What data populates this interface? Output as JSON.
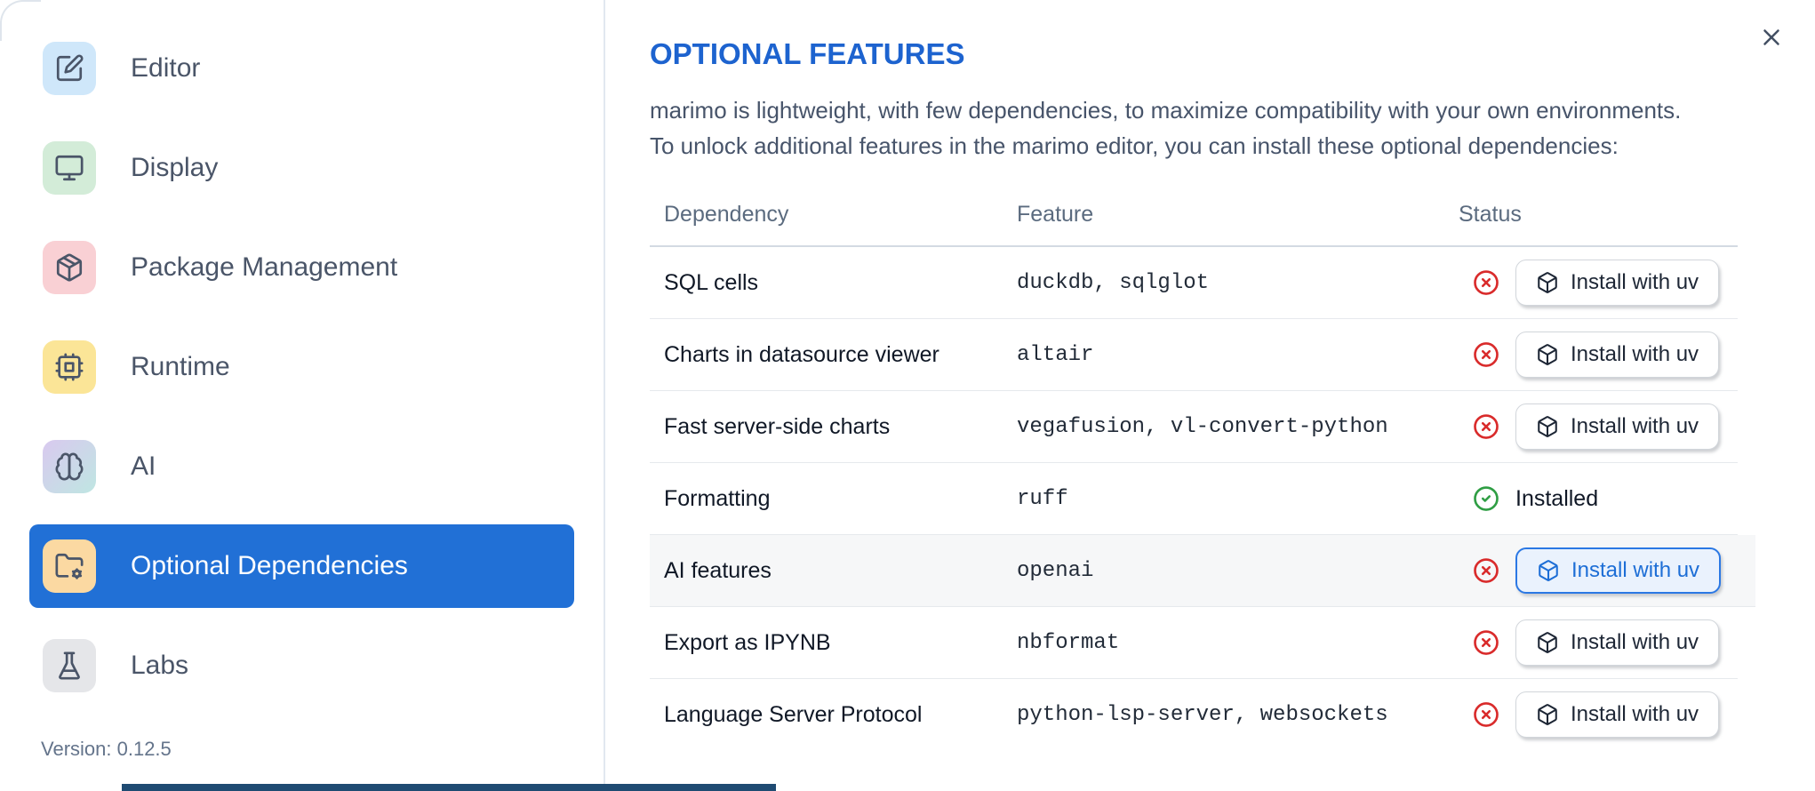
{
  "dialog": {
    "title": "OPTIONAL FEATURES",
    "description_lines": [
      "marimo is lightweight, with few dependencies, to maximize compatibility with your own environments.",
      "To unlock additional features in the marimo editor, you can install these optional dependencies:"
    ],
    "close_icon": "x-icon"
  },
  "sidebar": {
    "items": [
      {
        "label": "Editor",
        "icon": "edit-icon",
        "icon_bg": "#cfe7fa",
        "selected": false
      },
      {
        "label": "Display",
        "icon": "monitor-icon",
        "icon_bg": "#d3ecd8",
        "selected": false
      },
      {
        "label": "Package Management",
        "icon": "package-icon",
        "icon_bg": "#f9d0d4",
        "selected": false
      },
      {
        "label": "Runtime",
        "icon": "cpu-icon",
        "icon_bg": "#fbe597",
        "selected": false
      },
      {
        "label": "AI",
        "icon": "brain-icon",
        "icon_bg": "#d9c9ef",
        "icon_bg2": "#bfe6e2",
        "selected": false
      },
      {
        "label": "Optional Dependencies",
        "icon": "folder-cog-icon",
        "icon_bg": "#fbd9a2",
        "selected": true
      },
      {
        "label": "Labs",
        "icon": "flask-icon",
        "icon_bg": "#e5e6e9",
        "selected": false
      }
    ],
    "version": "Version: 0.12.5"
  },
  "table": {
    "headers": [
      "Dependency",
      "Feature",
      "Status"
    ],
    "status_missing_icon": "circle-x-icon",
    "status_installed_icon": "circle-check-icon",
    "install_button_icon": "box-icon",
    "rows": [
      {
        "dependency": "SQL cells",
        "feature": "duckdb, sqlglot",
        "installed": false,
        "action_label": "Install with uv",
        "highlighted": false
      },
      {
        "dependency": "Charts in datasource viewer",
        "feature": "altair",
        "installed": false,
        "action_label": "Install with uv",
        "highlighted": false
      },
      {
        "dependency": "Fast server-side charts",
        "feature": "vegafusion, vl-convert-python",
        "installed": false,
        "action_label": "Install with uv",
        "highlighted": false
      },
      {
        "dependency": "Formatting",
        "feature": "ruff",
        "installed": true,
        "status_label": "Installed",
        "highlighted": false
      },
      {
        "dependency": "AI features",
        "feature": "openai",
        "installed": false,
        "action_label": "Install with uv",
        "highlighted": true
      },
      {
        "dependency": "Export as IPYNB",
        "feature": "nbformat",
        "installed": false,
        "action_label": "Install with uv",
        "highlighted": false
      },
      {
        "dependency": "Language Server Protocol",
        "feature": "python-lsp-server, websockets",
        "installed": false,
        "action_label": "Install with uv",
        "highlighted": false
      }
    ]
  },
  "colors": {
    "accent_blue": "#2170d6",
    "title_blue": "#1d63cf",
    "error_red": "#d92b2b",
    "success_green": "#2f9e44",
    "primary_button_blue": "#1d6ed6",
    "highlight_bg": "#f6f7f8",
    "strip_blue": "#1f4b72"
  }
}
